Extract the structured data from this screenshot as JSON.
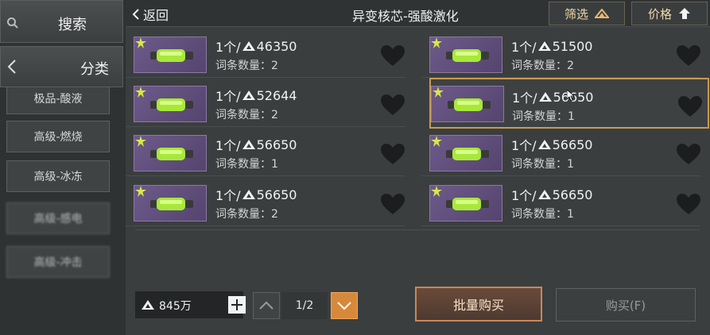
{
  "sidebar": {
    "search_label": "搜索",
    "category_label": "分类",
    "items": [
      {
        "label": "极品-酸液"
      },
      {
        "label": "高级-燃烧"
      },
      {
        "label": "高级-冰冻"
      },
      {
        "label": "高级-感电"
      },
      {
        "label": "高级-冲击"
      }
    ]
  },
  "topbar": {
    "back_label": "返回",
    "title": "异变核芯-强酸激化",
    "filter_label": "筛选",
    "price_label": "价格"
  },
  "listings": [
    {
      "qty_prefix": "1个/",
      "price": "46350",
      "count_label": "词条数量：",
      "count": "2"
    },
    {
      "qty_prefix": "1个/",
      "price": "51500",
      "count_label": "词条数量：",
      "count": "2"
    },
    {
      "qty_prefix": "1个/",
      "price": "52644",
      "count_label": "词条数量：",
      "count": "2"
    },
    {
      "qty_prefix": "1个/",
      "price": "56650",
      "count_label": "词条数量：",
      "count": "1"
    },
    {
      "qty_prefix": "1个/",
      "price": "56650",
      "count_label": "词条数量：",
      "count": "1"
    },
    {
      "qty_prefix": "1个/",
      "price": "56650",
      "count_label": "词条数量：",
      "count": "1"
    },
    {
      "qty_prefix": "1个/",
      "price": "56650",
      "count_label": "词条数量：",
      "count": "2"
    },
    {
      "qty_prefix": "1个/",
      "price": "56650",
      "count_label": "词条数量：",
      "count": "1"
    }
  ],
  "bottom": {
    "balance": "845万",
    "page_label": "1/2",
    "bulk_buy_label": "批量购买",
    "buy_label": "购买(F)"
  },
  "colors": {
    "accent_orange": "#d8883a",
    "selected_border": "#c89a52",
    "thumb_purple": "#6d5a8a"
  }
}
